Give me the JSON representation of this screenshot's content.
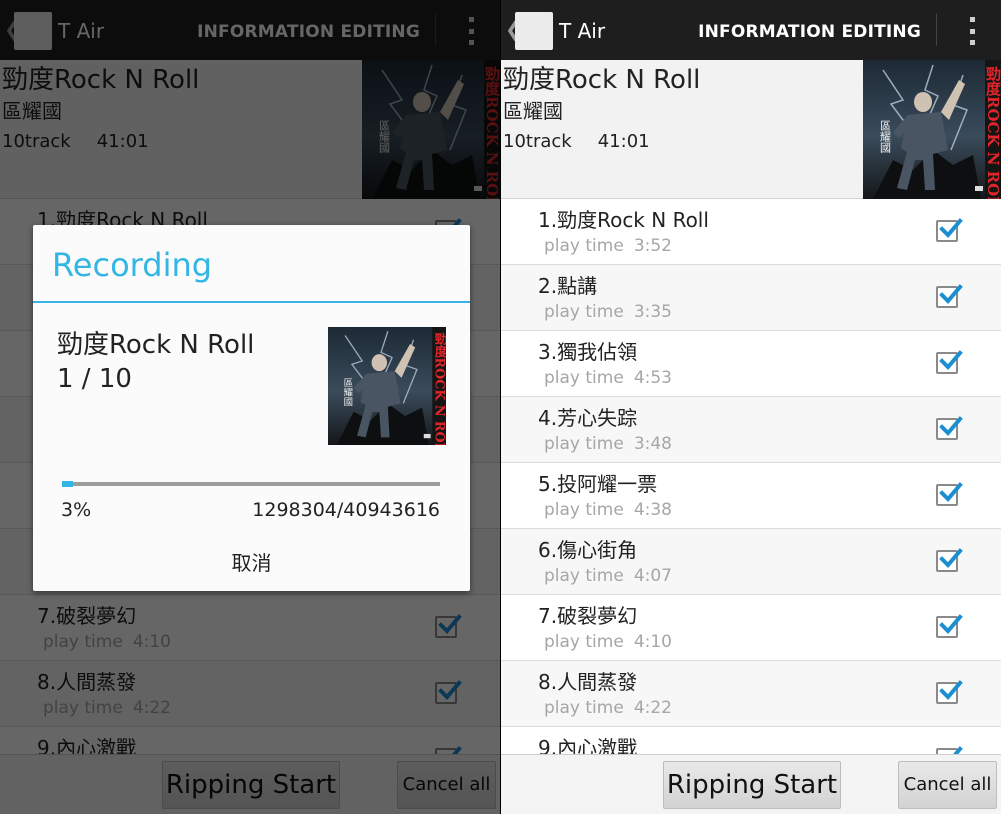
{
  "app": {
    "back_glyph": "❮",
    "title": "T Air",
    "action_label": "INFORMATION EDITING",
    "overflow_icon": "overflow-menu-icon"
  },
  "album": {
    "title": "勁度Rock N Roll",
    "artist": "區耀國",
    "track_count": "10track",
    "duration": "41:01"
  },
  "album_art_text": {
    "title_red": "勁度ROCK N ROLL",
    "artist_vertical": "區耀國"
  },
  "tracks": [
    {
      "title": "1.勁度Rock N Roll",
      "label": "play time",
      "time": "3:52",
      "checked": true
    },
    {
      "title": "2.點講",
      "label": "play time",
      "time": "3:35",
      "checked": true
    },
    {
      "title": "3.獨我佔領",
      "label": "play time",
      "time": "4:53",
      "checked": true
    },
    {
      "title": "4.芳心失踪",
      "label": "play time",
      "time": "3:48",
      "checked": true
    },
    {
      "title": "5.投阿耀一票",
      "label": "play time",
      "time": "4:38",
      "checked": true
    },
    {
      "title": "6.傷心街角",
      "label": "play time",
      "time": "4:07",
      "checked": true
    },
    {
      "title": "7.破裂夢幻",
      "label": "play time",
      "time": "4:10",
      "checked": true
    },
    {
      "title": "8.人間蒸發",
      "label": "play time",
      "time": "4:22",
      "checked": true
    },
    {
      "title": "9.內心激戰",
      "label": "",
      "time": "",
      "checked": true
    }
  ],
  "buttons": {
    "rip": "Ripping Start",
    "cancel_all": "Cancel all"
  },
  "dialog": {
    "title": "Recording",
    "album": "勁度Rock N Roll",
    "progress_count": "1 / 10",
    "percent_label": "3%",
    "progress_fraction": 0.03,
    "bytes": "1298304/40943616",
    "cancel": "取消"
  },
  "colors": {
    "accent": "#33b5e5",
    "actionbar": "#1e1e1e",
    "checkmark": "#1c8fd0"
  }
}
